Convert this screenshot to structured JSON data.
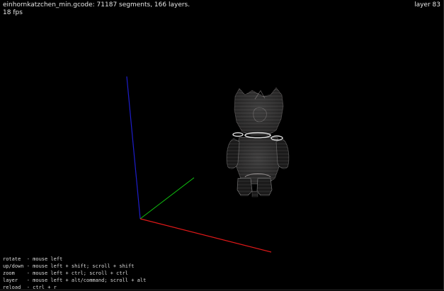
{
  "header": {
    "file_info": "einhornkatzchen_min.gcode: 71187 segments, 166 layers.",
    "fps": "18 fps",
    "layer": "layer 83"
  },
  "help": [
    "rotate  - mouse left",
    "up/down - mouse left + shift; scroll + shift",
    "zoom    - mouse left + ctrl; scroll + ctrl",
    "layer   - mouse left + alt/command; scroll + alt",
    "reload  - ctrl + r"
  ],
  "colors": {
    "background": "#000000",
    "axis_x": "#e01818",
    "axis_y": "#10c010",
    "axis_z": "#1e1ecc",
    "model": "#d8d0d0",
    "current_layer": "#ffffff"
  },
  "icons": {
    "x-axis": "red-line",
    "y-axis": "green-line",
    "z-axis": "blue-line",
    "model": "cat-figure-wireframe"
  }
}
